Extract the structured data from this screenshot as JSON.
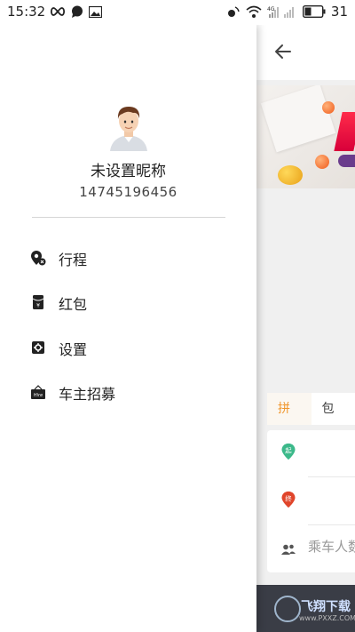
{
  "status_bar": {
    "time": "15:32",
    "battery": "31",
    "net_label": "4G",
    "icons": [
      "infinity-icon",
      "chat-bubble-icon",
      "image-icon",
      "nfc-icon",
      "wifi-icon",
      "signal-icon",
      "battery-icon"
    ]
  },
  "drawer": {
    "nickname": "未设置昵称",
    "phone": "14745196456",
    "menu": [
      {
        "label": "行程",
        "icon": "trip-pin-icon"
      },
      {
        "label": "红包",
        "icon": "red-packet-icon"
      },
      {
        "label": "设置",
        "icon": "settings-icon"
      },
      {
        "label": "车主招募",
        "icon": "hire-sign-icon"
      }
    ]
  },
  "main": {
    "tabs": [
      "拼车",
      "包车"
    ],
    "start_pin": "起",
    "end_pin": "终",
    "passenger_placeholder": "乘车人数",
    "watermark": "飞翔下载",
    "watermark_url": "www.PXXZ.COM"
  },
  "colors": {
    "accent": "#f0962c",
    "start_pin": "#3cb98a",
    "end_pin": "#e0452b",
    "bottom_bar": "#3a3d46"
  }
}
